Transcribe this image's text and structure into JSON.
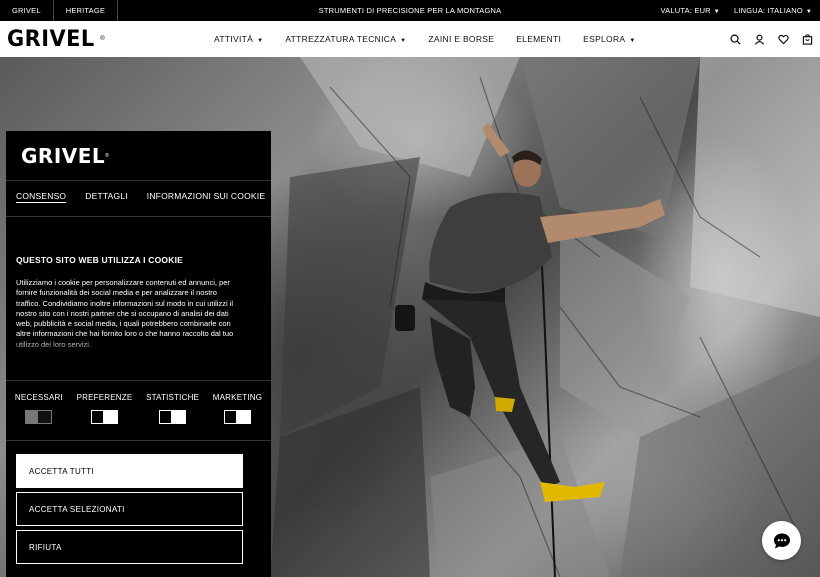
{
  "topbar": {
    "links": [
      "GRIVEL",
      "HERITAGE"
    ],
    "tagline": "STRUMENTI DI PRECISIONE PER LA MONTAGNA",
    "currency": "VALUTA: EUR",
    "language": "LINGUA: ITALIANO"
  },
  "header": {
    "logo": "GRIVEL",
    "nav": [
      "ATTIVITÀ",
      "ATTREZZATURA TECNICA",
      "ZAINI E BORSE",
      "ELEMENTI",
      "ESPLORA"
    ],
    "icons": [
      "search-icon",
      "user-icon",
      "heart-icon",
      "cart-icon"
    ]
  },
  "cookie": {
    "logo": "GRIVEL",
    "tabs": [
      "CONSENSO",
      "DETTAGLI",
      "INFORMAZIONI SUI COOKIE"
    ],
    "title": "QUESTO SITO WEB UTILIZZA I COOKIE",
    "body": "Utilizziamo i cookie per personalizzare contenuti ed annunci, per fornire funzionalità dei social media e per analizzare il nostro traffico. Condividiamo inoltre informazioni sul modo in cui utilizzi il nostro sito con i nostri partner che si occupano di analisi dei dati web, pubblicità e social media, i quali potrebbero combinarle con altre informazioni che hai fornito loro o che hanno raccolto dal tuo utilizzo dei loro servizi.",
    "categories": [
      {
        "label": "NECESSARI",
        "state": "disabled"
      },
      {
        "label": "PREFERENZE",
        "state": "off"
      },
      {
        "label": "STATISTICHE",
        "state": "off"
      },
      {
        "label": "MARKETING",
        "state": "off"
      }
    ],
    "buttons": {
      "accept_all": "ACCETTA TUTTI",
      "accept_selected": "ACCETTA SELEZIONATI",
      "reject": "RIFIUTA"
    }
  }
}
